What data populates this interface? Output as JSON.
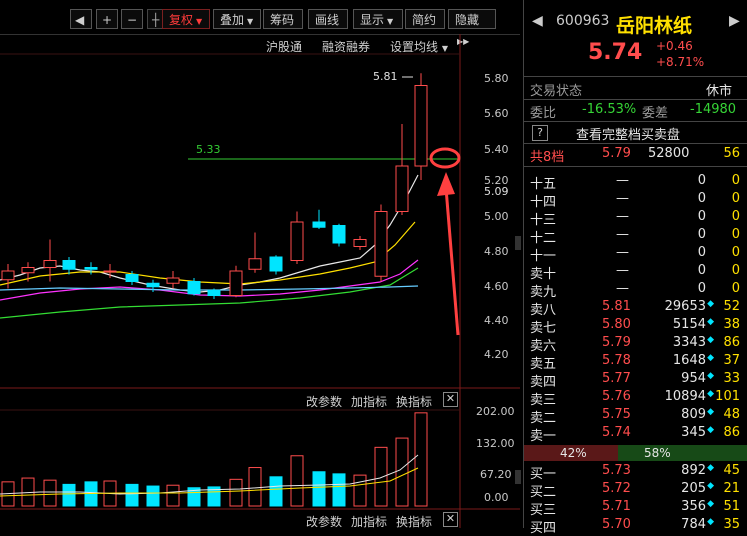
{
  "toolbar": {
    "prev": "◀",
    "plus": "+",
    "minus": "−",
    "adjust_label": "复权",
    "overlay_label": "叠加",
    "chips_label": "筹码",
    "draw_label": "画线",
    "display_label": "显示",
    "brief_label": "简约",
    "hide_label": "隐藏",
    "more": "▶▶"
  },
  "subtoolbar": {
    "hgt": "沪股通",
    "margin": "融资融券",
    "ma_settings": "设置均线"
  },
  "main_chart": {
    "price_ticks": [
      "5.80",
      "5.60",
      "5.40",
      "5.20",
      "5.09",
      "5.00",
      "4.80",
      "4.60",
      "4.40",
      "4.20"
    ],
    "high_label": "5.81",
    "line_label": "5.33"
  },
  "volume_panel": {
    "params_label": "改参数",
    "add_label": "加指标",
    "switch_label": "换指标",
    "ticks": [
      "202.00",
      "132.00",
      "67.20",
      "0.00"
    ]
  },
  "bottom_bar": {
    "params_label": "改参数",
    "add_label": "加指标",
    "switch_label": "换指标"
  },
  "stock": {
    "code": "600963",
    "name": "岳阳林纸",
    "price": "5.74",
    "change": "+0.46",
    "change_pct": "+8.71%",
    "status_label": "交易状态",
    "status_value": "休市",
    "wei_bi_label": "委比",
    "wei_bi_value": "-16.53%",
    "wei_cha_label": "委差",
    "wei_cha_value": "-14980",
    "full_book_label": "查看完整档买卖盘",
    "help_glyph": "?",
    "total_levels_label": "共8档",
    "total_price": "5.79",
    "total_volume": "52800",
    "total_count": "56"
  },
  "sell_levels": [
    {
      "label": "十五",
      "price": "—",
      "volume": "0",
      "count": "0"
    },
    {
      "label": "十四",
      "price": "—",
      "volume": "0",
      "count": "0"
    },
    {
      "label": "十三",
      "price": "—",
      "volume": "0",
      "count": "0"
    },
    {
      "label": "十二",
      "price": "—",
      "volume": "0",
      "count": "0"
    },
    {
      "label": "十一",
      "price": "—",
      "volume": "0",
      "count": "0"
    },
    {
      "label": "卖十",
      "price": "—",
      "volume": "0",
      "count": "0"
    },
    {
      "label": "卖九",
      "price": "—",
      "volume": "0",
      "count": "0"
    },
    {
      "label": "卖八",
      "price": "5.81",
      "volume": "29653",
      "count": "52"
    },
    {
      "label": "卖七",
      "price": "5.80",
      "volume": "5154",
      "count": "38"
    },
    {
      "label": "卖六",
      "price": "5.79",
      "volume": "3343",
      "count": "86"
    },
    {
      "label": "卖五",
      "price": "5.78",
      "volume": "1648",
      "count": "37"
    },
    {
      "label": "卖四",
      "price": "5.77",
      "volume": "954",
      "count": "33"
    },
    {
      "label": "卖三",
      "price": "5.76",
      "volume": "10894",
      "count": "101"
    },
    {
      "label": "卖二",
      "price": "5.75",
      "volume": "809",
      "count": "48"
    },
    {
      "label": "卖一",
      "price": "5.74",
      "volume": "345",
      "count": "86"
    }
  ],
  "ratio": {
    "buy_pct": "42%",
    "sell_pct": "58%",
    "buy_fraction": 0.42
  },
  "buy_levels": [
    {
      "label": "买一",
      "price": "5.73",
      "volume": "892",
      "count": "45"
    },
    {
      "label": "买二",
      "price": "5.72",
      "volume": "205",
      "count": "21"
    },
    {
      "label": "买三",
      "price": "5.71",
      "volume": "356",
      "count": "51"
    },
    {
      "label": "买四",
      "price": "5.70",
      "volume": "784",
      "count": "35"
    }
  ],
  "colors": {
    "up": "#ff4d4d",
    "down": "#00e5ff",
    "annotation": "#ff4040"
  }
}
